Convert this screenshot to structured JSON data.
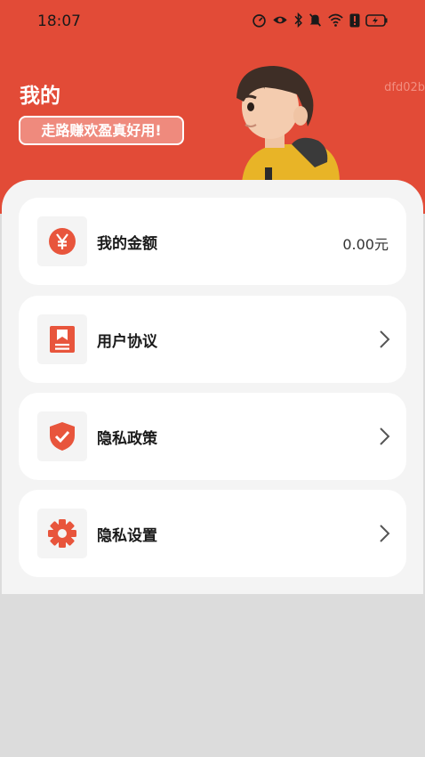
{
  "status_bar": {
    "time": "18:07",
    "icons": [
      "speed-meter-icon",
      "eye-icon",
      "bluetooth-icon",
      "mute-bell-icon",
      "wifi-icon",
      "alert-icon",
      "battery-charging-icon"
    ]
  },
  "header": {
    "title": "我的",
    "slogan": "走路赚欢盈真好用!",
    "user_id": "dfd02b",
    "colors": {
      "background": "#e24b37",
      "accent": "#e8553c"
    }
  },
  "menu": {
    "items": [
      {
        "label": "我的金额",
        "icon": "yuan-coin-icon",
        "value": "0.00元"
      },
      {
        "label": "用户协议",
        "icon": "agreement-book-icon"
      },
      {
        "label": "隐私政策",
        "icon": "shield-check-icon"
      },
      {
        "label": "隐私设置",
        "icon": "gear-icon"
      }
    ]
  }
}
